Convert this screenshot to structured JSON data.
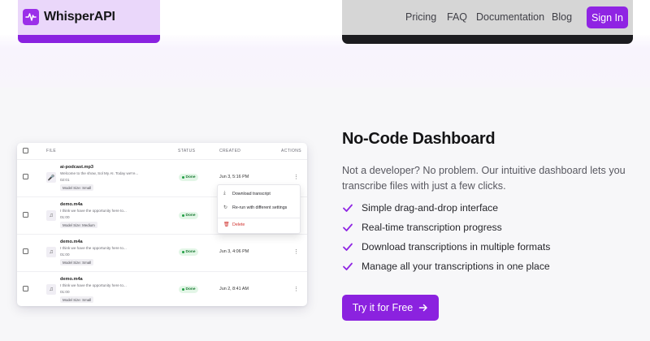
{
  "brand": {
    "name": "WhisperAPI",
    "accent": "#8f24e3",
    "logo_icon": "waveform-icon"
  },
  "nav": {
    "links": [
      "Pricing",
      "FAQ",
      "Documentation",
      "Blog"
    ],
    "signin_label": "Sign In"
  },
  "dashboard": {
    "columns": {
      "file": "FILE",
      "status": "STATUS",
      "created": "CREATED",
      "actions": "ACTIONS"
    },
    "rows": [
      {
        "file": "ai-podcast.mp3",
        "preview": "Welcome to the show, Sol My AI. Today we're...",
        "duration": "02:01",
        "model": "Model Size: Small",
        "status": "Done",
        "created": "Jun 3, 5:16 PM",
        "icon": "microphone-icon"
      },
      {
        "file": "demo.m4a",
        "preview": "I think we have the opportunity here to...",
        "duration": "01:00",
        "model": "Model Size: Medium",
        "status": "Done",
        "created": "",
        "icon": "music-note-icon"
      },
      {
        "file": "demo.m4a",
        "preview": "I think we have the opportunity here to...",
        "duration": "01:00",
        "model": "Model Size: Small",
        "status": "Done",
        "created": "Jun 3, 4:06 PM",
        "icon": "music-note-icon"
      },
      {
        "file": "demo.m4a",
        "preview": "I think we have the opportunity here to...",
        "duration": "01:00",
        "model": "Model Size: Small",
        "status": "Done",
        "created": "Jun 2, 8:41 AM",
        "icon": "music-note-icon"
      }
    ],
    "menu": {
      "download": "Download transcript",
      "rerun": "Re-run with different settings",
      "delete": "Delete"
    }
  },
  "feature": {
    "title": "No-Code Dashboard",
    "description": "Not a developer? No problem. Our intuitive dashboard lets you transcribe files with just a few clicks.",
    "items": [
      "Simple drag-and-drop interface",
      "Real-time transcription progress",
      "Download transcriptions in multiple formats",
      "Manage all your transcriptions in one place"
    ],
    "cta_label": "Try it for Free"
  }
}
